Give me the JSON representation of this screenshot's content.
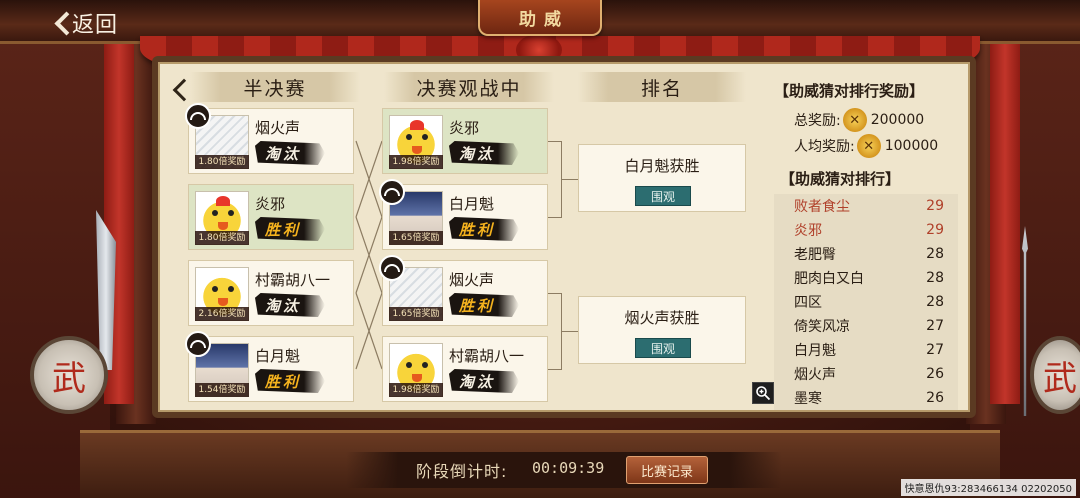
{
  "header": {
    "back_label": "返回",
    "title": "助威"
  },
  "columns": {
    "semi": "半决赛",
    "final": "决赛观战中",
    "rank": "排名"
  },
  "semifinal": [
    {
      "name": "烟火声",
      "odds": "1.80倍奖励",
      "result": "淘汰",
      "avatar": "sketch"
    },
    {
      "name": "炎邪",
      "odds": "1.80倍奖励",
      "result": "胜利",
      "avatar": "chick"
    },
    {
      "name": "村霸胡八一",
      "odds": "2.16倍奖励",
      "result": "淘汰",
      "avatar": "chick"
    },
    {
      "name": "白月魁",
      "odds": "1.54倍奖励",
      "result": "胜利",
      "avatar": "night"
    }
  ],
  "final": [
    {
      "name": "炎邪",
      "odds": "1.98倍奖励",
      "result": "淘汰",
      "avatar": "chick"
    },
    {
      "name": "白月魁",
      "odds": "1.65倍奖励",
      "result": "胜利",
      "avatar": "night"
    },
    {
      "name": "烟火声",
      "odds": "1.65倍奖励",
      "result": "胜利",
      "avatar": "sketch"
    },
    {
      "name": "村霸胡八一",
      "odds": "1.98倍奖励",
      "result": "淘汰",
      "avatar": "chick"
    }
  ],
  "ranking": [
    {
      "text": "白月魁获胜",
      "watch": "围观"
    },
    {
      "text": "烟火声获胜",
      "watch": "围观"
    }
  ],
  "rewards": {
    "title": "【助威猜对排行奖励】",
    "total_label": "总奖励:",
    "total_value": "200000",
    "avg_label": "人均奖励:",
    "avg_value": "100000"
  },
  "leaderboard": {
    "title": "【助威猜对排行】",
    "rows": [
      {
        "name": "败者食尘",
        "score": "29"
      },
      {
        "name": "炎邪",
        "score": "29"
      },
      {
        "name": "老肥臀",
        "score": "28"
      },
      {
        "name": "肥肉白又白",
        "score": "28"
      },
      {
        "name": "四区",
        "score": "28"
      },
      {
        "name": "倚笑风凉",
        "score": "27"
      },
      {
        "name": "白月魁",
        "score": "27"
      },
      {
        "name": "烟火声",
        "score": "26"
      },
      {
        "name": "墨寒",
        "score": "26"
      }
    ]
  },
  "timer": {
    "label": "阶段倒计时:",
    "value": "00:09:39",
    "record_button": "比赛记录"
  },
  "footer": {
    "id_text": "快意恩仇93:283466134 02202050"
  },
  "colors": {
    "win_card": "#dde4c4",
    "watch_button": "#2c6d70",
    "top_rank": "#b0402a"
  }
}
